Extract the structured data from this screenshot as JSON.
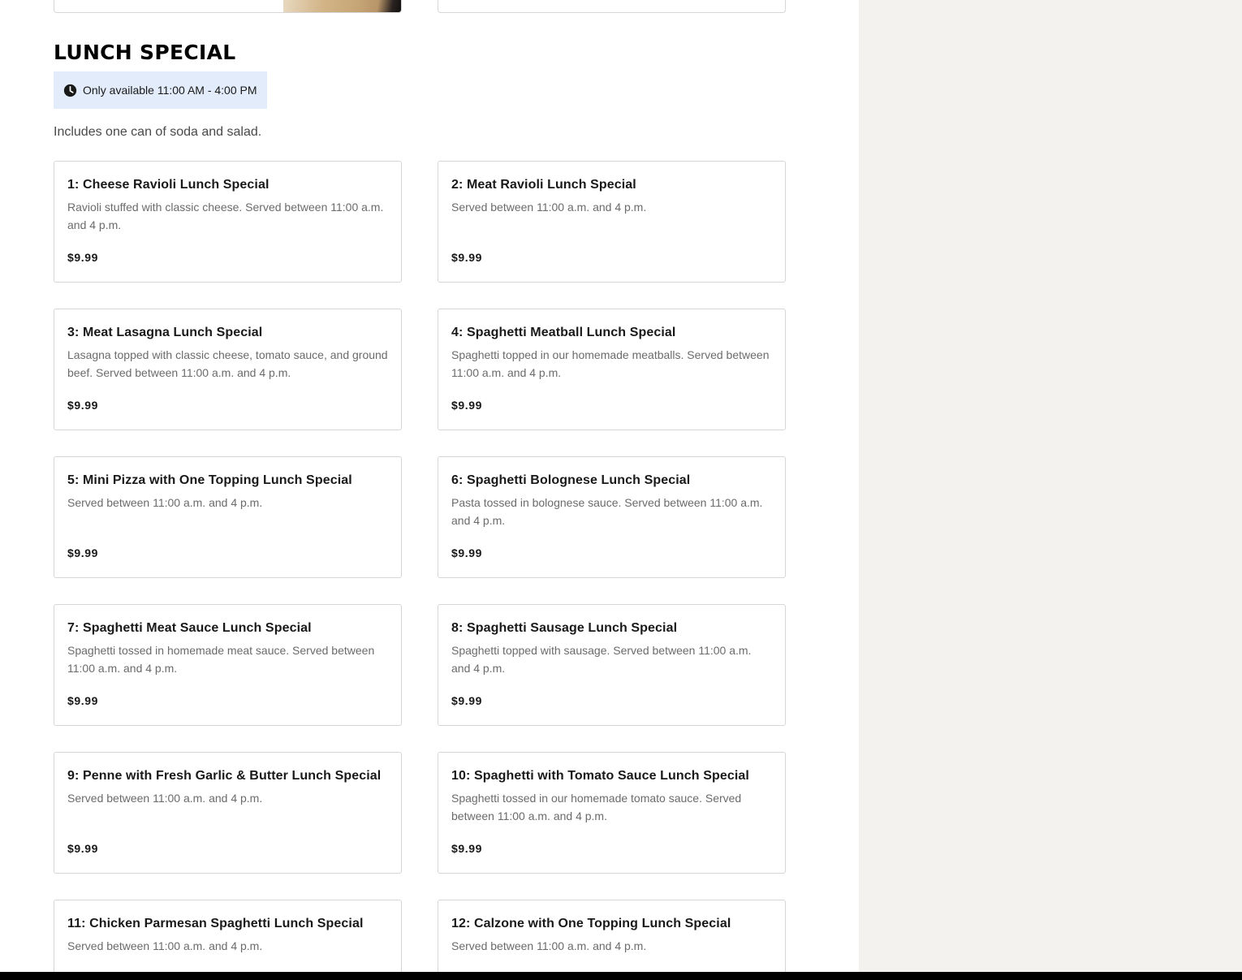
{
  "section": {
    "title": "LUNCH SPECIAL",
    "availability": "Only available 11:00 AM - 4:00 PM",
    "description": "Includes one can of soda and salad."
  },
  "items": [
    {
      "name": "1: Cheese Ravioli Lunch Special",
      "description": "Ravioli stuffed with classic cheese. Served between 11:00 a.m. and 4 p.m.",
      "price": "$9.99"
    },
    {
      "name": "2: Meat Ravioli Lunch Special",
      "description": "Served between 11:00 a.m. and 4 p.m.",
      "price": "$9.99"
    },
    {
      "name": "3: Meat Lasagna Lunch Special",
      "description": "Lasagna topped with classic cheese, tomato sauce, and ground beef. Served between 11:00 a.m. and 4 p.m.",
      "price": "$9.99"
    },
    {
      "name": "4: Spaghetti Meatball Lunch Special",
      "description": "Spaghetti topped in our homemade meatballs. Served between 11:00 a.m. and 4 p.m.",
      "price": "$9.99"
    },
    {
      "name": "5: Mini Pizza with One Topping Lunch Special",
      "description": "Served between 11:00 a.m. and 4 p.m.",
      "price": "$9.99"
    },
    {
      "name": "6: Spaghetti Bolognese Lunch Special",
      "description": "Pasta tossed in bolognese sauce. Served between 11:00 a.m. and 4 p.m.",
      "price": "$9.99"
    },
    {
      "name": "7: Spaghetti Meat Sauce Lunch Special",
      "description": "Spaghetti tossed in homemade meat sauce. Served between 11:00 a.m. and 4 p.m.",
      "price": "$9.99"
    },
    {
      "name": "8: Spaghetti Sausage Lunch Special",
      "description": "Spaghetti topped with sausage. Served between 11:00 a.m. and 4 p.m.",
      "price": "$9.99"
    },
    {
      "name": "9: Penne with Fresh Garlic & Butter Lunch Special",
      "description": "Served between 11:00 a.m. and 4 p.m.",
      "price": "$9.99"
    },
    {
      "name": "10: Spaghetti with Tomato Sauce Lunch Special",
      "description": "Spaghetti tossed in our homemade tomato sauce. Served between 11:00 a.m. and 4 p.m.",
      "price": "$9.99"
    },
    {
      "name": "11: Chicken Parmesan Spaghetti Lunch Special",
      "description": "Served between 11:00 a.m. and 4 p.m.",
      "price": ""
    },
    {
      "name": "12: Calzone with One Topping Lunch Special",
      "description": "Served between 11:00 a.m. and 4 p.m.",
      "price": ""
    }
  ],
  "icons": {
    "availability": "clock-icon"
  },
  "colors": {
    "badge_background": "#e3ecfb",
    "side_panel": "#f3f2ef",
    "card_border": "#d6d6d6",
    "text_primary": "#191919",
    "text_secondary": "#6b6b6b"
  }
}
